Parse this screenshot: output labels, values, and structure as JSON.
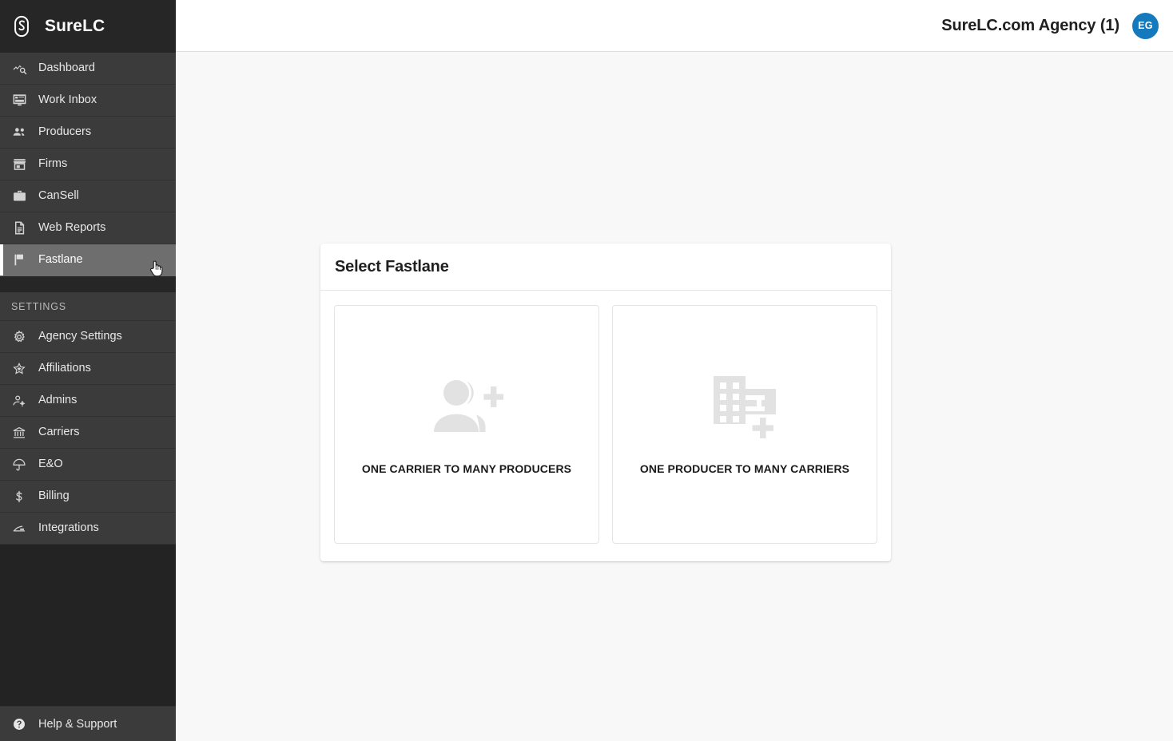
{
  "brand": {
    "name": "SureLC",
    "logo_icon": "surelc-logo-icon"
  },
  "topbar": {
    "account_name": "SureLC.com Agency (1)",
    "avatar_initials": "EG",
    "avatar_color": "#1479bd"
  },
  "sidebar": {
    "primary_items": [
      {
        "label": "Dashboard",
        "icon": "query-stats-icon",
        "active": false
      },
      {
        "label": "Work Inbox",
        "icon": "monitor-inbox-icon",
        "active": false
      },
      {
        "label": "Producers",
        "icon": "people-icon",
        "active": false
      },
      {
        "label": "Firms",
        "icon": "storefront-icon",
        "active": false
      },
      {
        "label": "CanSell",
        "icon": "briefcase-icon",
        "active": false
      },
      {
        "label": "Web Reports",
        "icon": "document-icon",
        "active": false
      },
      {
        "label": "Fastlane",
        "icon": "flag-icon",
        "active": true
      }
    ],
    "settings_section_label": "SETTINGS",
    "settings_items": [
      {
        "label": "Agency Settings",
        "icon": "gear-icon"
      },
      {
        "label": "Affiliations",
        "icon": "award-star-icon"
      },
      {
        "label": "Admins",
        "icon": "person-gear-icon"
      },
      {
        "label": "Carriers",
        "icon": "bank-icon"
      },
      {
        "label": "E&O",
        "icon": "umbrella-icon"
      },
      {
        "label": "Billing",
        "icon": "dollar-icon"
      },
      {
        "label": "Integrations",
        "icon": "integration-icon"
      }
    ],
    "help": {
      "label": "Help & Support",
      "icon": "help-circle-icon"
    }
  },
  "main": {
    "card_title": "Select Fastlane",
    "options": [
      {
        "label": "ONE CARRIER TO MANY PRODUCERS",
        "icon": "group-add-icon"
      },
      {
        "label": "ONE PRODUCER TO MANY CARRIERS",
        "icon": "domain-add-icon"
      }
    ]
  },
  "cursor": {
    "type": "pointer-hand-cursor"
  }
}
